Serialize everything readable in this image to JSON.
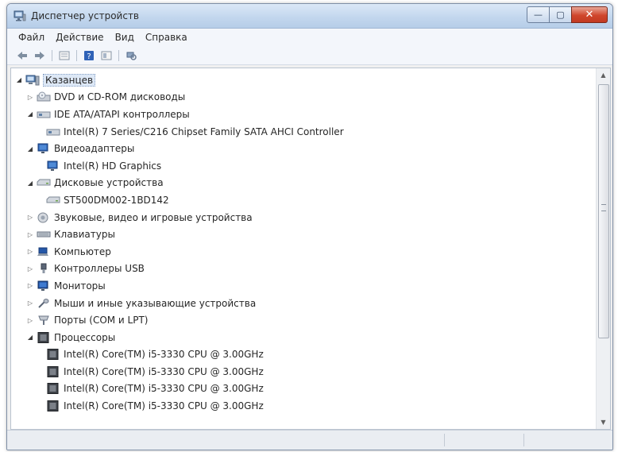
{
  "window": {
    "title": "Диспетчер устройств",
    "buttons": {
      "minimize": "—",
      "maximize": "▢",
      "close": "✕"
    }
  },
  "menu": [
    "Файл",
    "Действие",
    "Вид",
    "Справка"
  ],
  "toolbar": [
    "back-arrow-icon",
    "forward-arrow-icon",
    "properties-icon",
    "help-icon",
    "view-icon",
    "scan-hardware-icon"
  ],
  "tree": {
    "root": "Казанцев",
    "categories": [
      {
        "label": "DVD и CD-ROM дисководы",
        "expanded": false,
        "icon": "dvd-drive-icon",
        "children": []
      },
      {
        "label": "IDE ATA/ATAPI контроллеры",
        "expanded": true,
        "icon": "ide-controller-icon",
        "children": [
          "Intel(R) 7 Series/C216 Chipset Family SATA AHCI Controller"
        ]
      },
      {
        "label": "Видеоадаптеры",
        "expanded": true,
        "icon": "display-adapter-icon",
        "children": [
          "Intel(R) HD Graphics"
        ]
      },
      {
        "label": "Дисковые устройства",
        "expanded": true,
        "icon": "disk-drive-icon",
        "children": [
          "ST500DM002-1BD142"
        ]
      },
      {
        "label": "Звуковые, видео и игровые устройства",
        "expanded": false,
        "icon": "speaker-icon",
        "children": []
      },
      {
        "label": "Клавиатуры",
        "expanded": false,
        "icon": "keyboard-icon",
        "children": []
      },
      {
        "label": "Компьютер",
        "expanded": false,
        "icon": "computer-icon",
        "children": []
      },
      {
        "label": "Контроллеры USB",
        "expanded": false,
        "icon": "usb-icon",
        "children": []
      },
      {
        "label": "Мониторы",
        "expanded": false,
        "icon": "monitor-icon",
        "children": []
      },
      {
        "label": "Мыши и иные указывающие устройства",
        "expanded": false,
        "icon": "mouse-icon",
        "children": []
      },
      {
        "label": "Порты (COM и LPT)",
        "expanded": false,
        "icon": "port-icon",
        "children": []
      },
      {
        "label": "Процессоры",
        "expanded": true,
        "icon": "processor-icon",
        "children": [
          "Intel(R) Core(TM) i5-3330 CPU @ 3.00GHz",
          "Intel(R) Core(TM) i5-3330 CPU @ 3.00GHz",
          "Intel(R) Core(TM) i5-3330 CPU @ 3.00GHz",
          "Intel(R) Core(TM) i5-3330 CPU @ 3.00GHz"
        ]
      }
    ]
  },
  "colors": {
    "title_gradient_top": "#dbe8f7",
    "close_button": "#d0462c",
    "selection": "#dde8f6"
  }
}
